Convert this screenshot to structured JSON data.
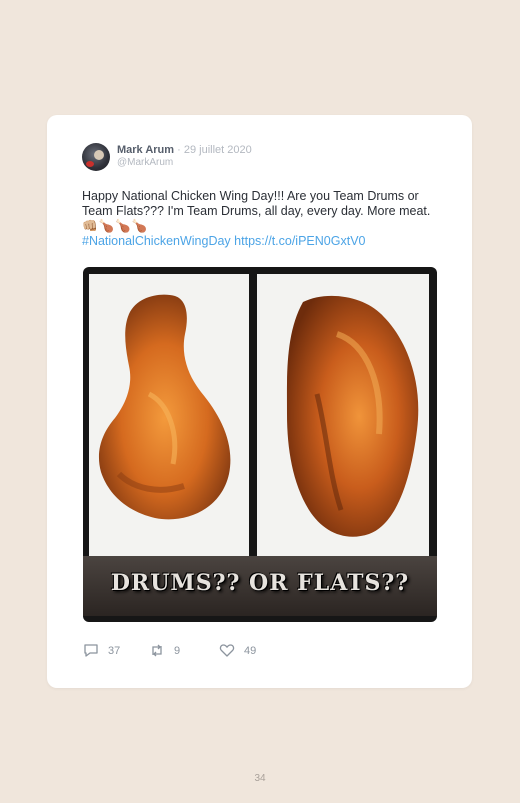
{
  "tweet": {
    "author_name": "Mark Arum",
    "separator": "·",
    "date": "29 juillet 2020",
    "handle": "@MarkArum",
    "text": "Happy National Chicken Wing Day!!! Are you Team Drums or Team Flats??? I'm Team Drums, all day, every day. More meat.",
    "emojis": "👊🏼🍗🍗🍗",
    "hashtag": "#NationalChickenWingDay",
    "url": "https://t.co/iPEN0GxtV0",
    "image_caption": "DRUMS?? OR FLATS??"
  },
  "actions": {
    "replies": "37",
    "retweets": "9",
    "likes": "49"
  },
  "icons": [
    "reply-icon",
    "retweet-icon",
    "like-icon"
  ],
  "colors": {
    "page_background": "#f0e6dc",
    "link": "#4ca4e6",
    "muted": "#8c949e"
  },
  "page_number": "34"
}
